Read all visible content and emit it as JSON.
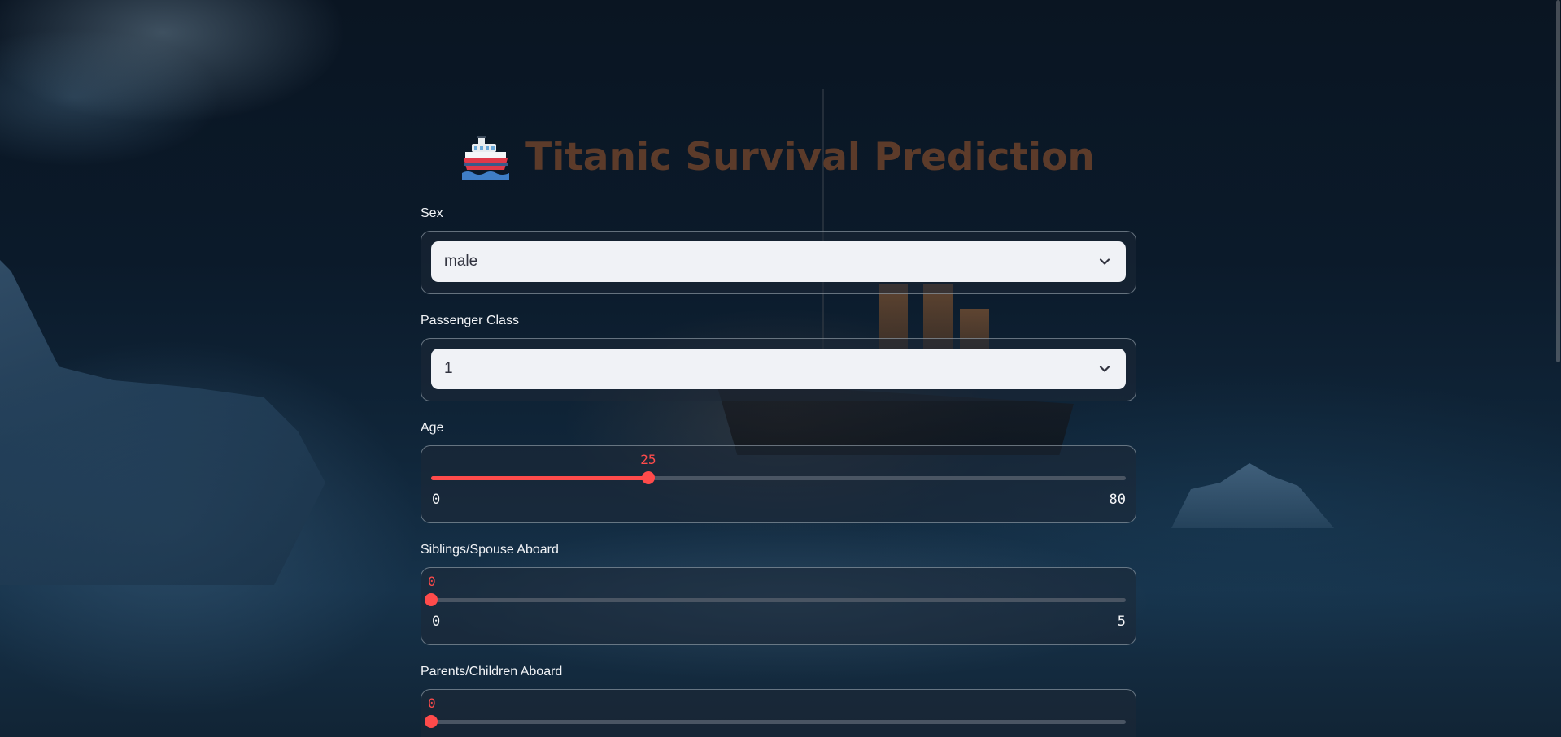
{
  "app": {
    "title": "Titanic Survival Prediction",
    "title_emoji": "ship-emoji"
  },
  "fields": {
    "sex": {
      "label": "Sex",
      "value": "male"
    },
    "pclass": {
      "label": "Passenger Class",
      "value": "1"
    },
    "age": {
      "label": "Age",
      "value": "25",
      "min": "0",
      "max": "80",
      "fraction": 0.3125
    },
    "sibsp": {
      "label": "Siblings/Spouse Aboard",
      "value": "0",
      "min": "0",
      "max": "5",
      "fraction": 0
    },
    "parch": {
      "label": "Parents/Children Aboard",
      "value": "0",
      "fraction": 0
    }
  },
  "colors": {
    "accent": "#ff4b4b",
    "title": "#5c3b2a",
    "select_bg": "#f0f2f6"
  }
}
